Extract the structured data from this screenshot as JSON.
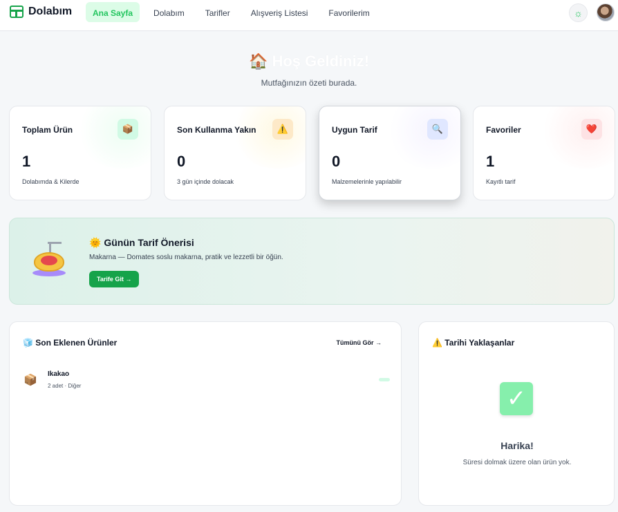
{
  "nav": {
    "brand": "Dolabım",
    "links": [
      {
        "label": "Ana Sayfa",
        "active": true
      },
      {
        "label": "Dolabım",
        "active": false
      },
      {
        "label": "Tarifler",
        "active": false
      },
      {
        "label": "Alışveriş Listesi",
        "active": false
      },
      {
        "label": "Favorilerim",
        "active": false
      }
    ],
    "theme_icon": "sun-icon",
    "avatar": "user-avatar"
  },
  "hero": {
    "title": "Hoş Geldiniz!",
    "icon": "🏠",
    "subtitle": "Mutfağınızın özeti burada."
  },
  "stats": [
    {
      "title": "Toplam Ürün",
      "value": "1",
      "desc": "Dolabımda & Kilerde",
      "icon": "📦",
      "icon_name": "box-icon",
      "color": "#22c55e"
    },
    {
      "title": "Son Kullanma Yakın",
      "value": "0",
      "desc": "3 gün içinde dolacak",
      "icon": "⚠️",
      "icon_name": "warning-icon",
      "color": "#f59e0b"
    },
    {
      "title": "Uygun Tarif",
      "value": "0",
      "desc": "Malzemelerinle yapılabilir",
      "icon": "🔍",
      "icon_name": "search-icon",
      "color": "#8b5cf6"
    },
    {
      "title": "Favoriler",
      "value": "1",
      "desc": "Kayıtlı tarif",
      "icon": "❤️",
      "icon_name": "heart-icon",
      "color": "#ef4444"
    }
  ],
  "recipe_of_day": {
    "icon": "🌞",
    "title": "Günün Tarif Önerisi",
    "desc": "Makarna — Domates soslu makarna, pratik ve lezzetli bir öğün.",
    "button": "Tarife Git →"
  },
  "recent": {
    "icon": "🧊",
    "title": "Son Eklenen Ürünler",
    "see_all": "Tümünü Gör →",
    "items": [
      {
        "icon": "📦",
        "name": "Ikakao",
        "meta": "2 adet · Diğer"
      }
    ]
  },
  "expiring": {
    "icon": "⚠️",
    "title": "Tarihi Yaklaşanlar",
    "empty_icon": "✓",
    "empty_title": "Harika!",
    "empty_desc": "Süresi dolmak üzere olan ürün yok."
  }
}
